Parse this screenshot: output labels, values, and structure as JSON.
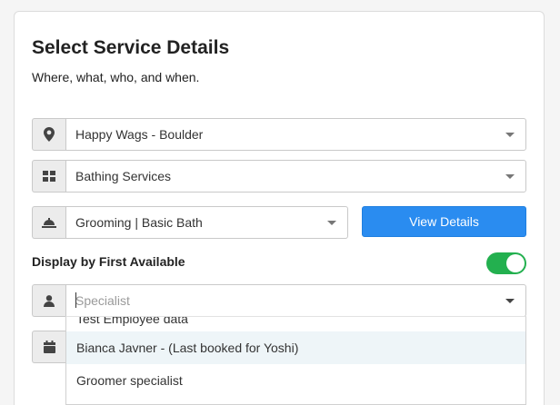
{
  "header": {
    "title": "Select Service Details",
    "subtitle": "Where, what, who, and when."
  },
  "location": {
    "icon": "map-pin-icon",
    "value": "Happy Wags - Boulder"
  },
  "category": {
    "icon": "grid-icon",
    "value": "Bathing Services"
  },
  "service": {
    "icon": "service-bell-icon",
    "value": "Grooming | Basic Bath"
  },
  "view_details": {
    "label": "View Details"
  },
  "first_available": {
    "label": "Display by First Available",
    "enabled": true
  },
  "specialist": {
    "icon": "user-icon",
    "placeholder": "Specialist",
    "options": [
      "Test Employee data",
      "Bianca Javner - (Last booked for Yoshi)",
      "Groomer specialist"
    ]
  },
  "date": {
    "icon": "calendar-icon"
  },
  "colors": {
    "accent": "#2a8cf0",
    "toggle_on": "#23b04f",
    "highlight": "#eef5f8"
  }
}
